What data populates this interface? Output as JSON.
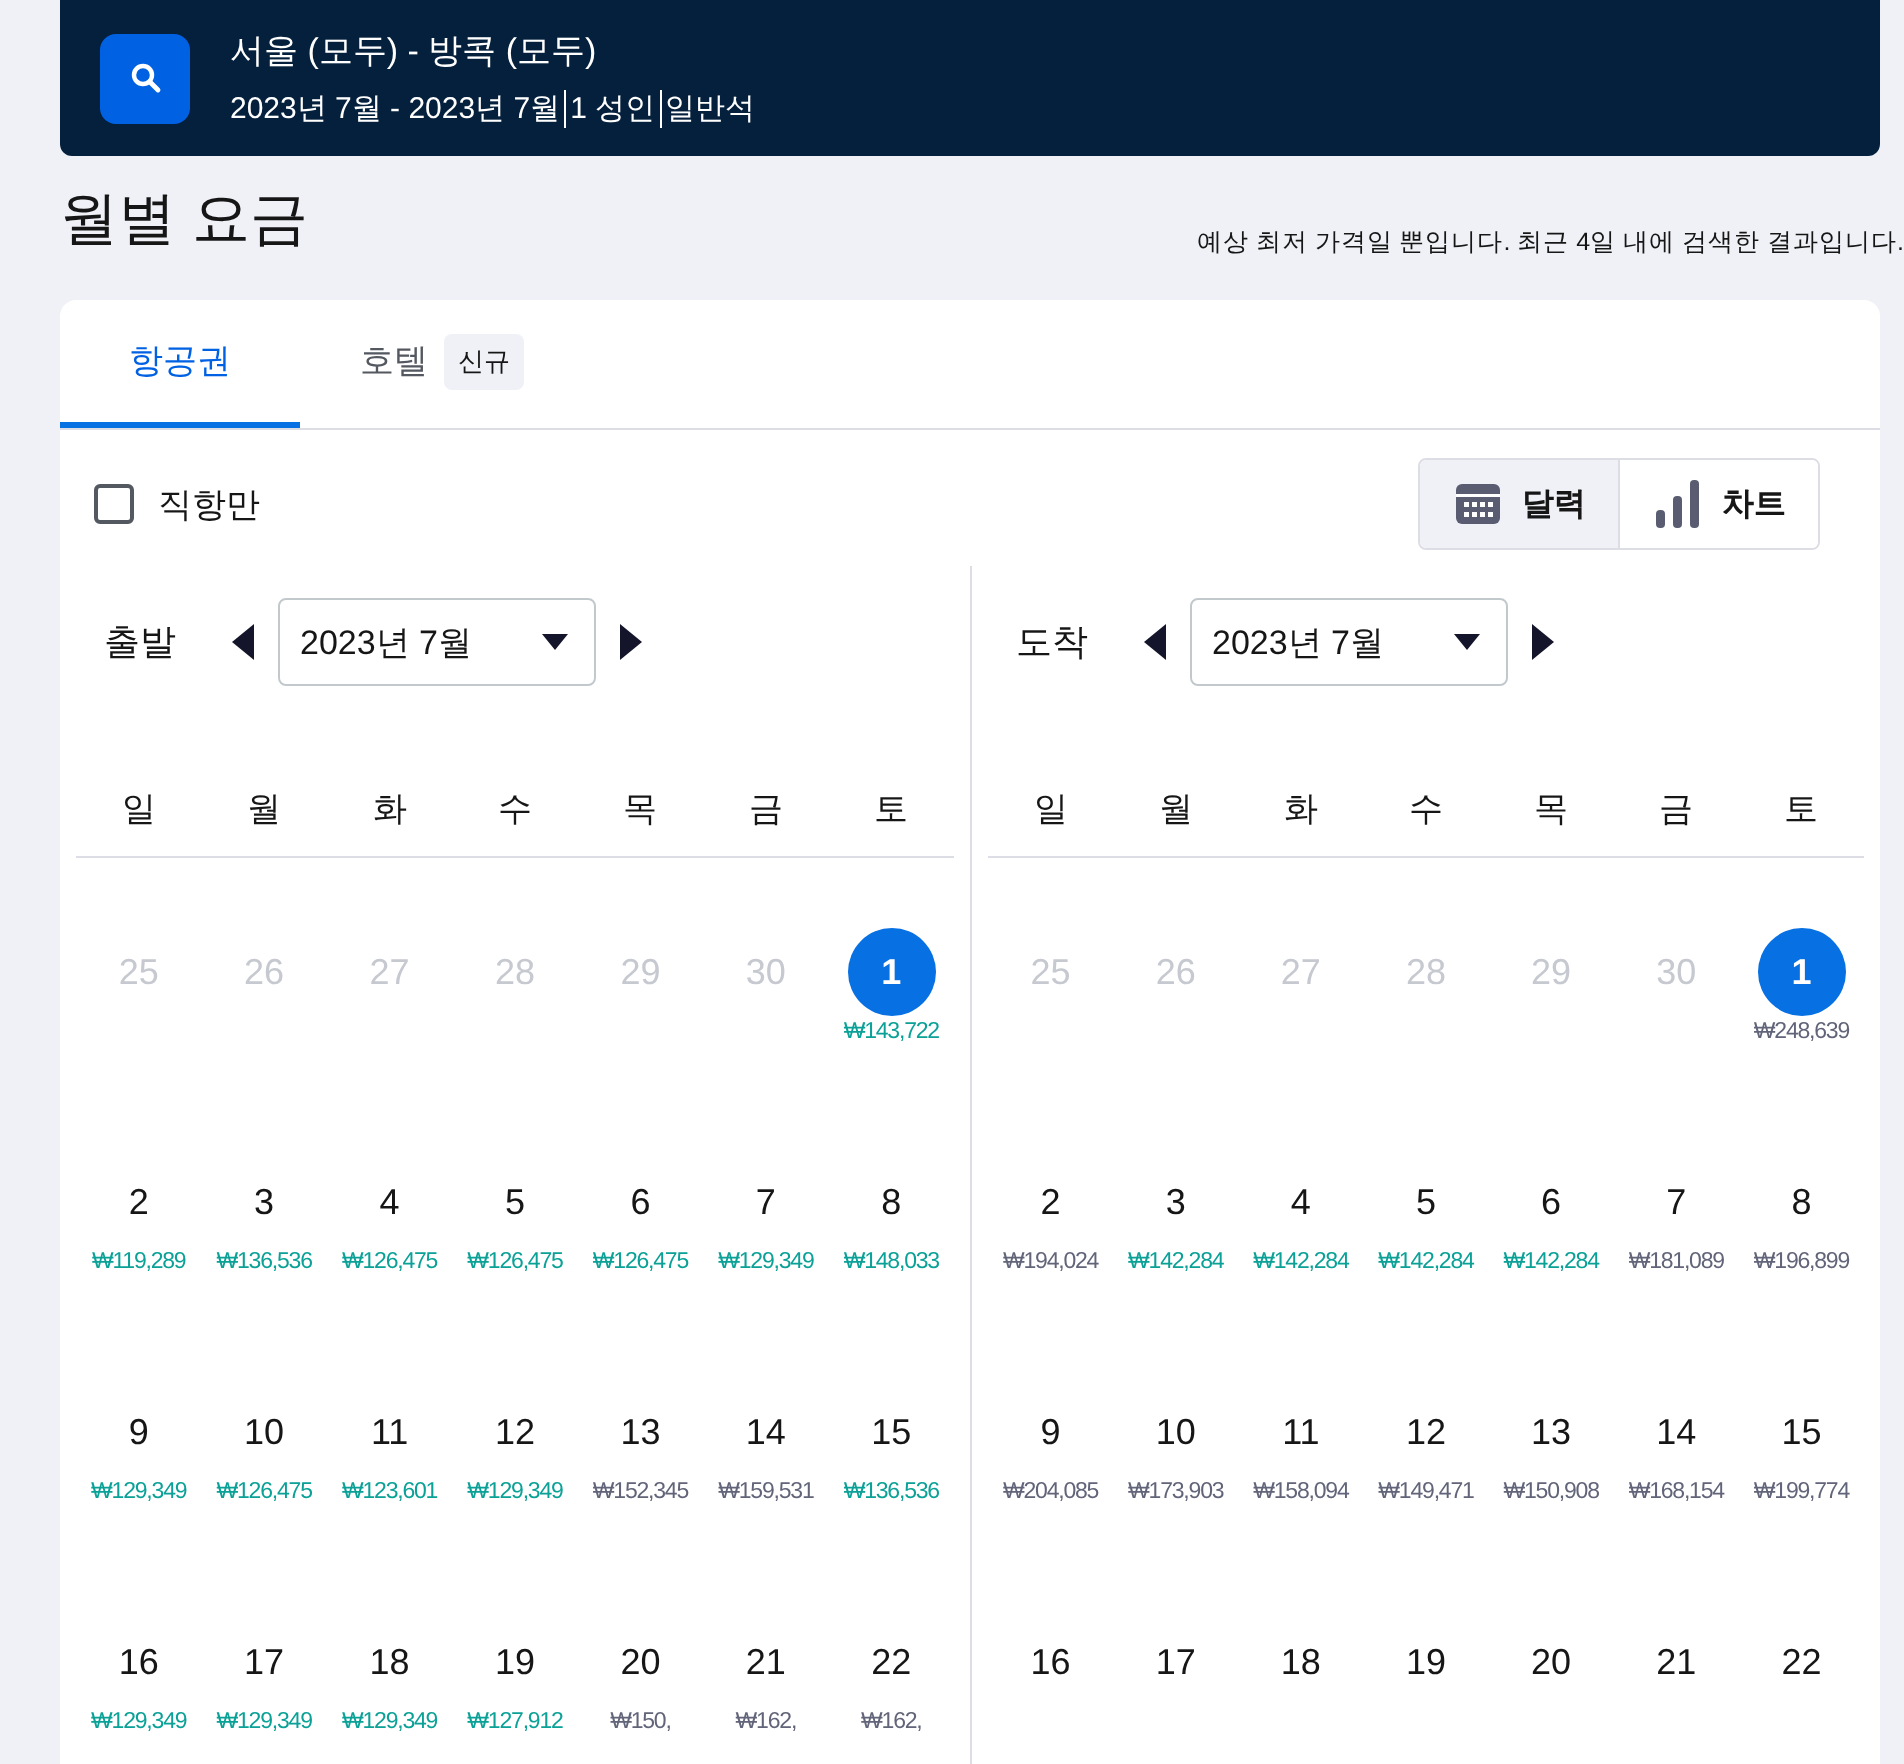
{
  "search_bar": {
    "route": "서울 (모두) - 방콕 (모두)",
    "details": [
      "2023년 7월 - 2023년 7월",
      "1 성인",
      "일반석"
    ]
  },
  "heading": "월별 요금",
  "note": "예상 최저 가격일 뿐입니다. 최근 4일 내에 검색한 결과입니다.",
  "tabs": [
    {
      "label": "항공권",
      "selected": true
    },
    {
      "label": "호텔",
      "badge": "신규",
      "selected": false
    }
  ],
  "direct_only": {
    "label": "직항만",
    "checked": false
  },
  "view_toggle": [
    {
      "label": "달력",
      "kind": "calendar",
      "selected": true
    },
    {
      "label": "차트",
      "kind": "chart",
      "selected": false
    }
  ],
  "calendars": [
    {
      "label": "출발",
      "month": "2023년 7월",
      "weekdays": [
        "일",
        "월",
        "화",
        "수",
        "목",
        "금",
        "토"
      ],
      "days": [
        {
          "day": "25",
          "kind": "outside",
          "selected": false
        },
        {
          "day": "26",
          "kind": "outside",
          "selected": false
        },
        {
          "day": "27",
          "kind": "outside",
          "selected": false
        },
        {
          "day": "28",
          "kind": "outside",
          "selected": false
        },
        {
          "day": "29",
          "kind": "outside",
          "selected": false
        },
        {
          "day": "30",
          "kind": "outside",
          "selected": false
        },
        {
          "day": "1",
          "kind": "day",
          "selected": true,
          "price": "₩143,722",
          "color": "#0ba197"
        },
        {
          "day": "2",
          "kind": "day",
          "selected": false,
          "price": "₩119,289",
          "color": "#0ba197"
        },
        {
          "day": "3",
          "kind": "day",
          "selected": false,
          "price": "₩136,536",
          "color": "#0ba197"
        },
        {
          "day": "4",
          "kind": "day",
          "selected": false,
          "price": "₩126,475",
          "color": "#0ba197"
        },
        {
          "day": "5",
          "kind": "day",
          "selected": false,
          "price": "₩126,475",
          "color": "#0ba197"
        },
        {
          "day": "6",
          "kind": "day",
          "selected": false,
          "price": "₩126,475",
          "color": "#0ba197"
        },
        {
          "day": "7",
          "kind": "day",
          "selected": false,
          "price": "₩129,349",
          "color": "#0ba197"
        },
        {
          "day": "8",
          "kind": "day",
          "selected": false,
          "price": "₩148,033",
          "color": "#0ba197"
        },
        {
          "day": "9",
          "kind": "day",
          "selected": false,
          "price": "₩129,349",
          "color": "#0ba197"
        },
        {
          "day": "10",
          "kind": "day",
          "selected": false,
          "price": "₩126,475",
          "color": "#0ba197"
        },
        {
          "day": "11",
          "kind": "day",
          "selected": false,
          "price": "₩123,601",
          "color": "#0ba197"
        },
        {
          "day": "12",
          "kind": "day",
          "selected": false,
          "price": "₩129,349",
          "color": "#0ba197"
        },
        {
          "day": "13",
          "kind": "day",
          "selected": false,
          "price": "₩152,345",
          "color": "#626579"
        },
        {
          "day": "14",
          "kind": "day",
          "selected": false,
          "price": "₩159,531",
          "color": "#626579"
        },
        {
          "day": "15",
          "kind": "day",
          "selected": false,
          "price": "₩136,536",
          "color": "#0ba197"
        },
        {
          "day": "16",
          "kind": "day",
          "selected": false,
          "price": "₩129,349",
          "color": "#0ba197"
        },
        {
          "day": "17",
          "kind": "day",
          "selected": false,
          "price": "₩129,349",
          "color": "#0ba197"
        },
        {
          "day": "18",
          "kind": "day",
          "selected": false,
          "price": "₩129,349",
          "color": "#0ba197"
        },
        {
          "day": "19",
          "kind": "day",
          "selected": false,
          "price": "₩127,912",
          "color": "#0ba197"
        },
        {
          "day": "20",
          "kind": "day",
          "selected": false,
          "price": "₩150,",
          "color": "#626579"
        },
        {
          "day": "21",
          "kind": "day",
          "selected": false,
          "price": "₩162,",
          "color": "#626579"
        },
        {
          "day": "22",
          "kind": "day",
          "selected": false,
          "price": "₩162,",
          "color": "#626579"
        }
      ]
    },
    {
      "label": "도착",
      "month": "2023년 7월",
      "weekdays": [
        "일",
        "월",
        "화",
        "수",
        "목",
        "금",
        "토"
      ],
      "days": [
        {
          "day": "25",
          "kind": "outside",
          "selected": false
        },
        {
          "day": "26",
          "kind": "outside",
          "selected": false
        },
        {
          "day": "27",
          "kind": "outside",
          "selected": false
        },
        {
          "day": "28",
          "kind": "outside",
          "selected": false
        },
        {
          "day": "29",
          "kind": "outside",
          "selected": false
        },
        {
          "day": "30",
          "kind": "outside",
          "selected": false
        },
        {
          "day": "1",
          "kind": "day",
          "selected": true,
          "price": "₩248,639",
          "color": "#626579"
        },
        {
          "day": "2",
          "kind": "day",
          "selected": false,
          "price": "₩194,024",
          "color": "#626579"
        },
        {
          "day": "3",
          "kind": "day",
          "selected": false,
          "price": "₩142,284",
          "color": "#0ba197"
        },
        {
          "day": "4",
          "kind": "day",
          "selected": false,
          "price": "₩142,284",
          "color": "#0ba197"
        },
        {
          "day": "5",
          "kind": "day",
          "selected": false,
          "price": "₩142,284",
          "color": "#0ba197"
        },
        {
          "day": "6",
          "kind": "day",
          "selected": false,
          "price": "₩142,284",
          "color": "#0ba197"
        },
        {
          "day": "7",
          "kind": "day",
          "selected": false,
          "price": "₩181,089",
          "color": "#626579"
        },
        {
          "day": "8",
          "kind": "day",
          "selected": false,
          "price": "₩196,899",
          "color": "#626579"
        },
        {
          "day": "9",
          "kind": "day",
          "selected": false,
          "price": "₩204,085",
          "color": "#626579"
        },
        {
          "day": "10",
          "kind": "day",
          "selected": false,
          "price": "₩173,903",
          "color": "#626579"
        },
        {
          "day": "11",
          "kind": "day",
          "selected": false,
          "price": "₩158,094",
          "color": "#626579"
        },
        {
          "day": "12",
          "kind": "day",
          "selected": false,
          "price": "₩149,471",
          "color": "#626579"
        },
        {
          "day": "13",
          "kind": "day",
          "selected": false,
          "price": "₩150,908",
          "color": "#626579"
        },
        {
          "day": "14",
          "kind": "day",
          "selected": false,
          "price": "₩168,154",
          "color": "#626579"
        },
        {
          "day": "15",
          "kind": "day",
          "selected": false,
          "price": "₩199,774",
          "color": "#626579"
        },
        {
          "day": "16",
          "kind": "day",
          "selected": false
        },
        {
          "day": "17",
          "kind": "day",
          "selected": false
        },
        {
          "day": "18",
          "kind": "day",
          "selected": false
        },
        {
          "day": "19",
          "kind": "day",
          "selected": false
        },
        {
          "day": "20",
          "kind": "day",
          "selected": false
        },
        {
          "day": "21",
          "kind": "day",
          "selected": false
        },
        {
          "day": "22",
          "kind": "day",
          "selected": false
        }
      ]
    }
  ]
}
